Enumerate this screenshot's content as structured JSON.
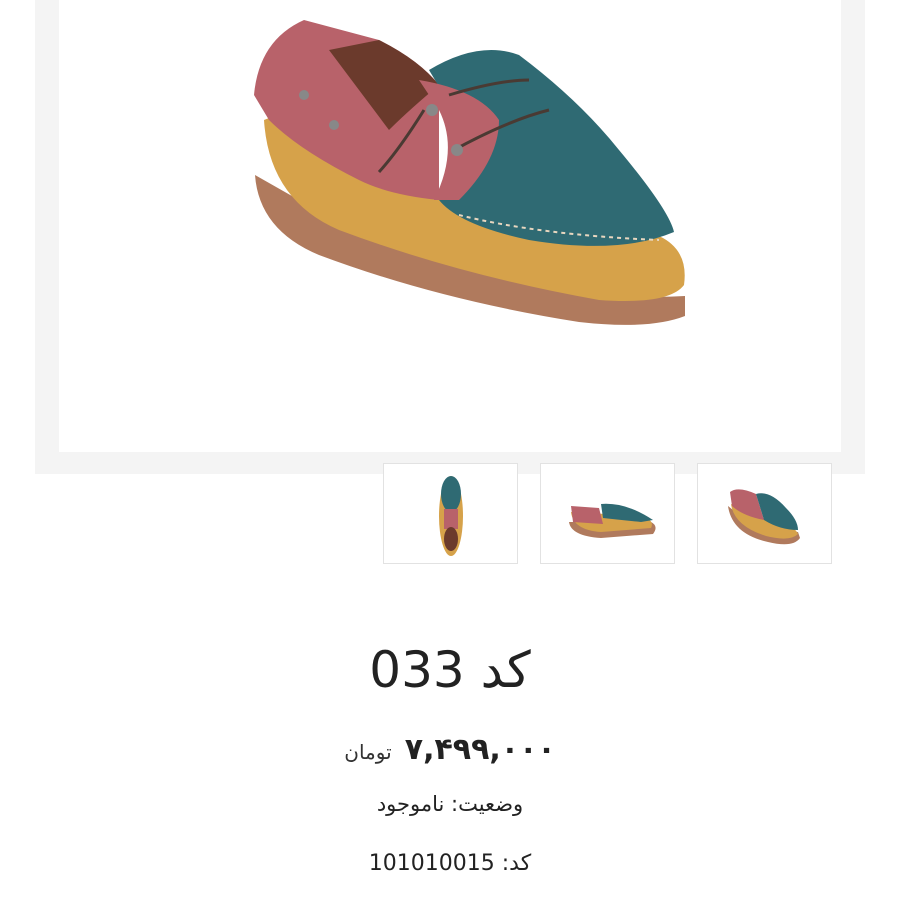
{
  "gallery": {
    "main_image_alt": "shoe-product-photo",
    "thumbnails": [
      {
        "alt": "shoe-top-view"
      },
      {
        "alt": "shoe-side-view"
      },
      {
        "alt": "shoe-angle-view"
      }
    ],
    "colors": {
      "teal": "#2f6a73",
      "mustard": "#d6a24a",
      "rose": "#b8626a",
      "sole": "#b07a5d",
      "frame": "#f4f4f4"
    }
  },
  "product": {
    "title": "کد 033",
    "price": "۷,۴۹۹,۰۰۰",
    "currency": "تومان",
    "status": "وضعیت: ناموجود",
    "code": "کد: 101010015"
  }
}
